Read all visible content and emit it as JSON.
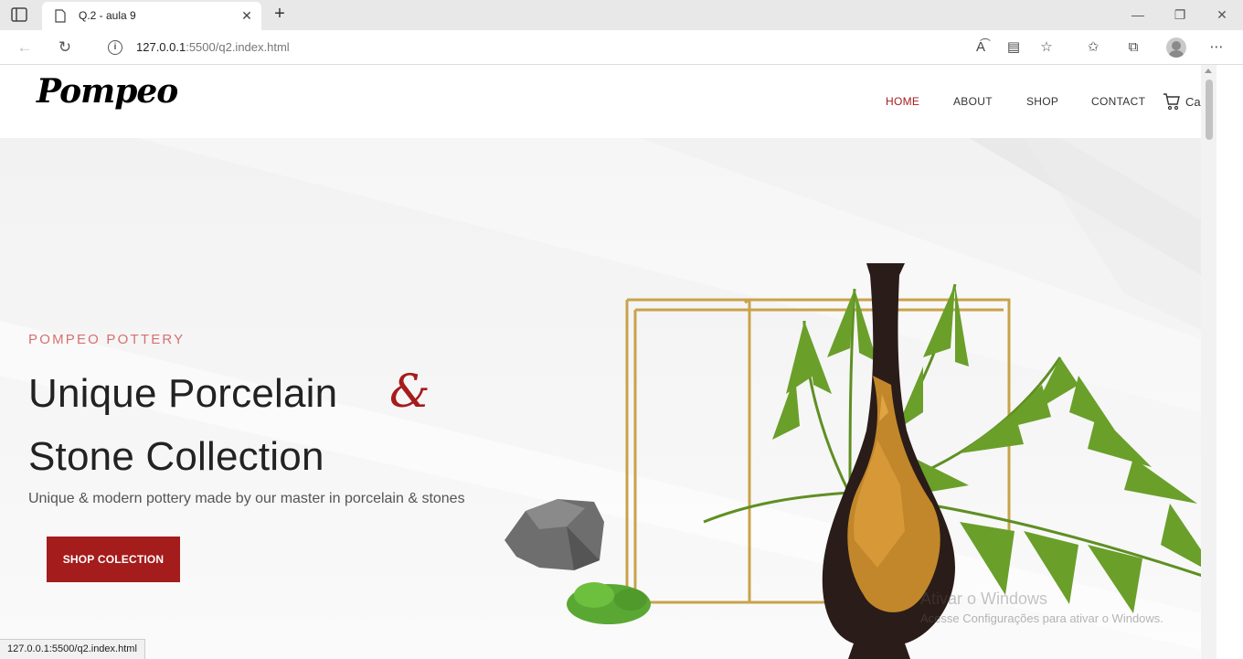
{
  "browser": {
    "tab_title": "Q.2 - aula 9",
    "url_host": "127.0.0.1",
    "url_rest": ":5500/q2.index.html",
    "status_url": "127.0.0.1:5500/q2.index.html"
  },
  "site": {
    "logo": "Pompeo",
    "nav": [
      {
        "label": "HOME",
        "active": true
      },
      {
        "label": "ABOUT",
        "active": false
      },
      {
        "label": "SHOP",
        "active": false
      },
      {
        "label": "CONTACT",
        "active": false
      }
    ],
    "cart_label": "Cart"
  },
  "hero": {
    "eyebrow": "POMPEO POTTERY",
    "title_line1": "Unique Porcelain",
    "ampersand": "&",
    "title_line2": "Stone Collection",
    "subtitle": "Unique & modern pottery made by our master in porcelain & stones",
    "cta_label": "SHOP COLECTION"
  },
  "watermark": {
    "title": "Ativar o Windows",
    "text": "Acesse Configurações para ativar o Windows."
  },
  "colors": {
    "accent": "#a51c1c",
    "eyebrow": "#d67070"
  }
}
